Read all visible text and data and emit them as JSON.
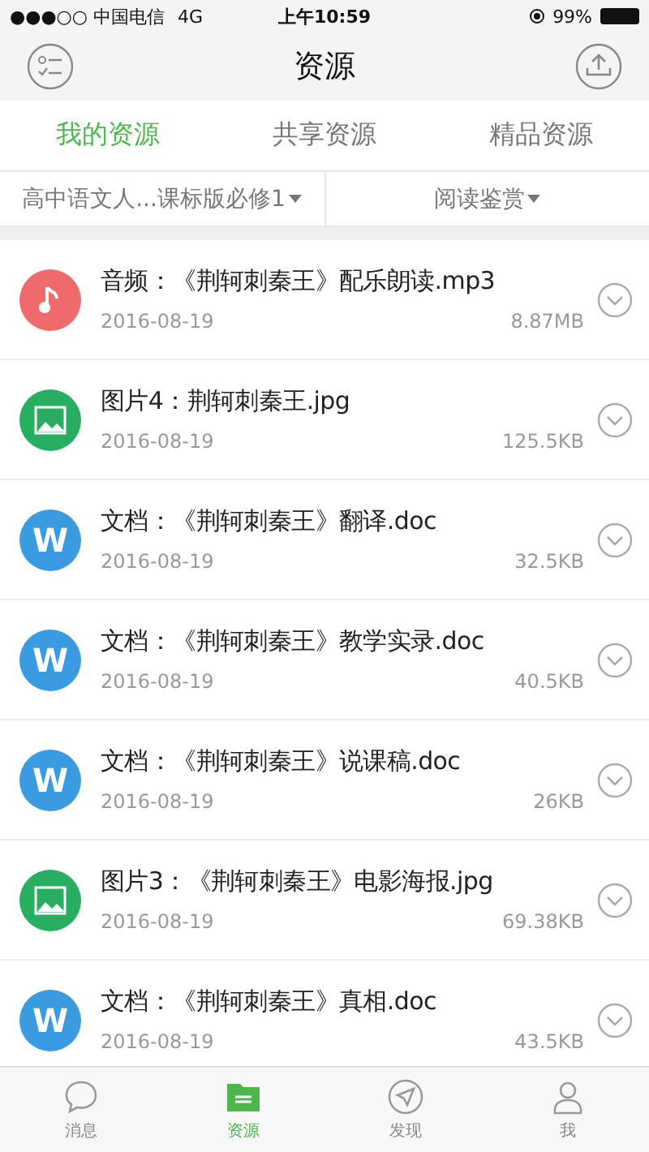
{
  "status_bar": {
    "carrier": "●●●○○ 中国电信",
    "network": "4G",
    "time": "上午10:59",
    "battery": "99%"
  },
  "nav": {
    "title": "资源"
  },
  "tabs": [
    {
      "label": "我的资源",
      "selected": true
    },
    {
      "label": "共享资源",
      "selected": false
    },
    {
      "label": "精品资源",
      "selected": false
    }
  ],
  "filters": [
    {
      "label": "高中语文人...课标版必修1"
    },
    {
      "label": "阅读鉴赏"
    }
  ],
  "files": [
    {
      "kind": "audio",
      "name": "音频：《荆轲刺秦王》配乐朗读.mp3",
      "date": "2016-08-19",
      "size": "8.87MB"
    },
    {
      "kind": "image",
      "name": "图片4：荆轲刺秦王.jpg",
      "date": "2016-08-19",
      "size": "125.5KB"
    },
    {
      "kind": "doc",
      "icon_letter": "W",
      "name": "文档：《荆轲刺秦王》翻译.doc",
      "date": "2016-08-19",
      "size": "32.5KB"
    },
    {
      "kind": "doc",
      "icon_letter": "W",
      "name": "文档：《荆轲刺秦王》教学实录.doc",
      "date": "2016-08-19",
      "size": "40.5KB"
    },
    {
      "kind": "doc",
      "icon_letter": "W",
      "name": "文档：《荆轲刺秦王》说课稿.doc",
      "date": "2016-08-19",
      "size": "26KB"
    },
    {
      "kind": "image",
      "name": "图片3：《荆轲刺秦王》电影海报.jpg",
      "date": "2016-08-19",
      "size": "69.38KB"
    },
    {
      "kind": "doc",
      "icon_letter": "W",
      "name": "文档：《荆轲刺秦王》真相.doc",
      "date": "2016-08-19",
      "size": "43.5KB"
    }
  ],
  "tab_bar": [
    {
      "kind": "chat",
      "label": "消息",
      "selected": false
    },
    {
      "kind": "folder",
      "label": "资源",
      "selected": true
    },
    {
      "kind": "compass",
      "label": "发现",
      "selected": false
    },
    {
      "kind": "person",
      "label": "我",
      "selected": false
    }
  ]
}
